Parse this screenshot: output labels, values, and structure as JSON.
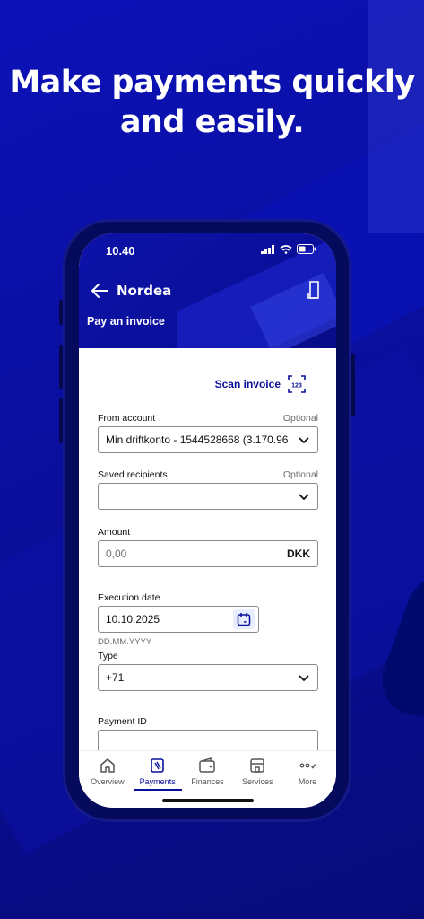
{
  "headline": {
    "line1": "Make payments quickly",
    "line2": "and easily."
  },
  "status_bar": {
    "time": "10.40"
  },
  "header": {
    "logo": "Nordea",
    "title": "Pay an invoice"
  },
  "scan": {
    "label": "Scan invoice"
  },
  "form": {
    "from_account": {
      "label": "From account",
      "optional": "Optional",
      "value": "Min driftkonto - 1544528668 (3.170.96"
    },
    "saved_recipients": {
      "label": "Saved recipients",
      "optional": "Optional",
      "value": ""
    },
    "amount": {
      "label": "Amount",
      "placeholder": "0,00",
      "currency": "DKK"
    },
    "execution_date": {
      "label": "Execution date",
      "value": "10.10.2025",
      "hint": "DD.MM.YYYY"
    },
    "type": {
      "label": "Type",
      "value": "+71"
    },
    "payment_id": {
      "label": "Payment ID",
      "value": ""
    }
  },
  "tabbar": {
    "items": [
      {
        "label": "Overview",
        "icon": "home-icon"
      },
      {
        "label": "Payments",
        "icon": "payments-icon",
        "active": true
      },
      {
        "label": "Finances",
        "icon": "wallet-icon"
      },
      {
        "label": "Services",
        "icon": "services-icon"
      },
      {
        "label": "More",
        "icon": "more-icon"
      }
    ]
  },
  "colors": {
    "brand": "#0a0fa8",
    "accent": "#0a0f9a",
    "background": "#ffffff"
  }
}
